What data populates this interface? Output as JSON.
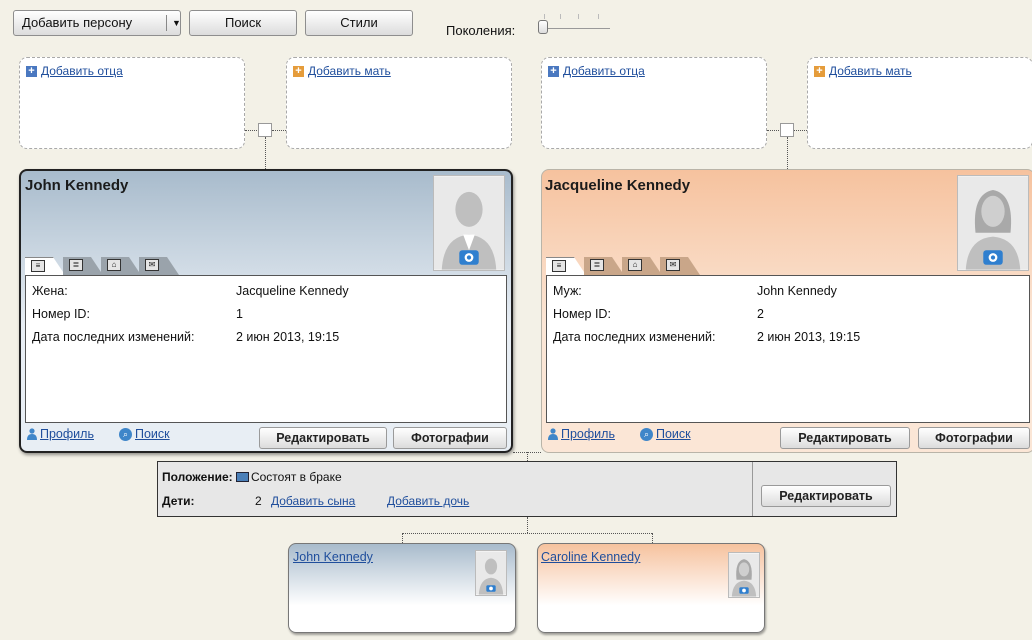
{
  "toolbar": {
    "add_person_label": "Добавить персону",
    "search_label": "Поиск",
    "styles_label": "Стили",
    "generations_label": "Поколения:"
  },
  "parents": {
    "john_father": "Добавить отца",
    "john_mother": "Добавить мать",
    "jackie_father": "Добавить отца",
    "jackie_mother": "Добавить мать"
  },
  "person_john": {
    "name": "John Kennedy",
    "spouse_label": "Жена:",
    "spouse_value": "Jacqueline Kennedy",
    "id_label": "Номер ID:",
    "id_value": "1",
    "modified_label": "Дата последних изменений:",
    "modified_value": "2 июн 2013, 19:15",
    "profile_link": "Профиль",
    "search_link": "Поиск",
    "edit_button": "Редактировать",
    "photos_button": "Фотографии"
  },
  "person_jackie": {
    "name": "Jacqueline Kennedy",
    "spouse_label": "Муж:",
    "spouse_value": "John Kennedy",
    "id_label": "Номер ID:",
    "id_value": "2",
    "modified_label": "Дата последних изменений:",
    "modified_value": "2 июн 2013, 19:15",
    "profile_link": "Профиль",
    "search_link": "Поиск",
    "edit_button": "Редактировать",
    "photos_button": "Фотографии"
  },
  "marriage": {
    "status_label": "Положение:",
    "status_value": "Состоят в браке",
    "children_label": "Дети:",
    "children_count": "2",
    "add_son": "Добавить сына",
    "add_daughter": "Добавить дочь",
    "edit_button": "Редактировать"
  },
  "children": [
    {
      "name": "John Kennedy"
    },
    {
      "name": "Caroline Kennedy"
    }
  ],
  "colors": {
    "male_card": "#a8bbcc",
    "female_card": "#f6c29e",
    "link": "#1f4e9c"
  }
}
